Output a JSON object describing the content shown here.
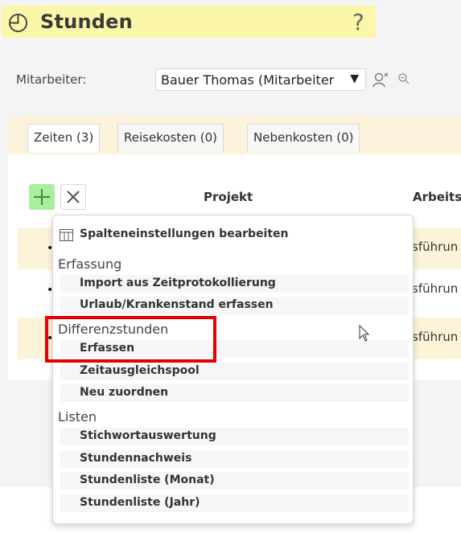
{
  "header": {
    "title": "Stunden",
    "help_icon": "?"
  },
  "filter": {
    "label": "Mitarbeiter:",
    "selected": "Bauer Thomas (Mitarbeiter",
    "arrow": "▼"
  },
  "tabs": [
    {
      "label": "Zeiten (3)",
      "active": true
    },
    {
      "label": "Reisekosten (0)",
      "active": false
    },
    {
      "label": "Nebenkosten (0)",
      "active": false
    }
  ],
  "table": {
    "columns": [
      "Projekt",
      "Arbeits"
    ],
    "rows": [
      {
        "bullet": "•",
        "text": "sführun"
      },
      {
        "bullet": "•",
        "text": "sführun"
      },
      {
        "bullet": "•",
        "text": "sführun"
      }
    ]
  },
  "menu": {
    "top_item": "Spalteneinstellungen bearbeiten",
    "sections": [
      {
        "heading": "Erfassung",
        "items": [
          "Import aus Zeitprotokollierung",
          "Urlaub/Krankenstand erfassen"
        ]
      },
      {
        "heading": "Differenzstunden",
        "items": [
          "Erfassen",
          "Zeitausgleichspool",
          "Neu zuordnen"
        ]
      },
      {
        "heading": "Listen",
        "items": [
          "Stichwortauswertung",
          "Stundennachweis",
          "Stundenliste (Monat)",
          "Stundenliste (Jahr)"
        ]
      }
    ]
  },
  "colors": {
    "title_bg": "#fbf6a8",
    "tabs_bg": "#fdf3dc",
    "add_button": "#a9ee9d",
    "highlight": "#e60000"
  }
}
